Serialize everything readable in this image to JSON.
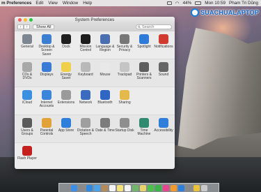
{
  "menubar": {
    "app_name": "m Preferences",
    "menus": [
      "Edit",
      "View",
      "Window",
      "Help"
    ],
    "battery": "44%",
    "clock": "Mon 10:59",
    "user": "Pham Tri Dũng"
  },
  "watermark": {
    "text": "SUACHUALAPTOP"
  },
  "window": {
    "title": "System Preferences",
    "show_all": "Show All",
    "search_placeholder": "Search"
  },
  "panes": [
    {
      "label": "General",
      "icon": "general-icon",
      "color": "#7d8590"
    },
    {
      "label": "Desktop & Screen Saver",
      "icon": "desktop-icon",
      "color": "#3c7ed0"
    },
    {
      "label": "Dock",
      "icon": "dock-icon",
      "color": "#1f1f1f"
    },
    {
      "label": "Mission Control",
      "icon": "mission-control-icon",
      "color": "#1c1c1c"
    },
    {
      "label": "Language & Region",
      "icon": "flag-icon",
      "color": "#4a6fb0"
    },
    {
      "label": "Security & Privacy",
      "icon": "lock-icon",
      "color": "#777777"
    },
    {
      "label": "Spotlight",
      "icon": "spotlight-icon",
      "color": "#2f7bd9"
    },
    {
      "label": "Notifications",
      "icon": "notifications-icon",
      "color": "#d13a2e"
    },
    {
      "label": "CDs & DVDs",
      "icon": "disc-icon",
      "color": "#a8a8a8"
    },
    {
      "label": "Displays",
      "icon": "display-icon",
      "color": "#3a7bd5"
    },
    {
      "label": "Energy Saver",
      "icon": "bulb-icon",
      "color": "#f0cf4a"
    },
    {
      "label": "Keyboard",
      "icon": "keyboard-icon",
      "color": "#b9b9b9"
    },
    {
      "label": "Mouse",
      "icon": "mouse-icon",
      "color": "#e9e9e9"
    },
    {
      "label": "Trackpad",
      "icon": "trackpad-icon",
      "color": "#c4c4c4"
    },
    {
      "label": "Printers & Scanners",
      "icon": "printer-icon",
      "color": "#5d5d5d"
    },
    {
      "label": "Sound",
      "icon": "speaker-icon",
      "color": "#666666"
    },
    {
      "label": "iCloud",
      "icon": "icloud-icon",
      "color": "#3a8fe0"
    },
    {
      "label": "Internet Accounts",
      "icon": "at-icon",
      "color": "#3a86d8"
    },
    {
      "label": "Extensions",
      "icon": "extensions-icon",
      "color": "#9a9a9a"
    },
    {
      "label": "Network",
      "icon": "globe-icon",
      "color": "#3c6cc0"
    },
    {
      "label": "Bluetooth",
      "icon": "bluetooth-icon",
      "color": "#2f66c4"
    },
    {
      "label": "Sharing",
      "icon": "sharing-icon",
      "color": "#e4b84a"
    },
    {
      "label": "Users & Groups",
      "icon": "users-icon",
      "color": "#5a5a5a"
    },
    {
      "label": "Parental Controls",
      "icon": "parental-icon",
      "color": "#e2a23a"
    },
    {
      "label": "App Store",
      "icon": "app-store-icon",
      "color": "#2e7fdc"
    },
    {
      "label": "Dictation & Speech",
      "icon": "microphone-icon",
      "color": "#9e9e9e"
    },
    {
      "label": "Date & Time",
      "icon": "clock-icon",
      "color": "#7c7c7c"
    },
    {
      "label": "Startup Disk",
      "icon": "disk-icon",
      "color": "#8f8f8f"
    },
    {
      "label": "Time Machine",
      "icon": "time-machine-icon",
      "color": "#2f8a6e"
    },
    {
      "label": "Accessibility",
      "icon": "accessibility-icon",
      "color": "#2f7fd8"
    },
    {
      "label": "Flash Player",
      "icon": "flash-icon",
      "color": "#c4201e"
    }
  ],
  "dock": {
    "icons": [
      "finder-icon",
      "launchpad-icon",
      "safari-icon",
      "mail-icon",
      "contacts-icon",
      "calendar-icon",
      "notes-icon",
      "reminders-icon",
      "maps-icon",
      "photos-icon",
      "messages-icon",
      "facetime-icon",
      "itunes-icon",
      "ibooks-icon",
      "app-store-icon",
      "system-preferences-icon",
      "chrome-icon",
      "trash-icon"
    ],
    "colors": [
      "#3d8ee6",
      "#8a8a8a",
      "#2f89e0",
      "#4aa3e8",
      "#b48a5a",
      "#f4f4f4",
      "#f6e27a",
      "#f4f4f4",
      "#6fb86b",
      "#e8d36a",
      "#4bc24b",
      "#3bb54a",
      "#e5478e",
      "#f29a2e",
      "#2e7fdc",
      "#8a8a8a",
      "#e9c23a",
      "#c9c9c9"
    ]
  }
}
